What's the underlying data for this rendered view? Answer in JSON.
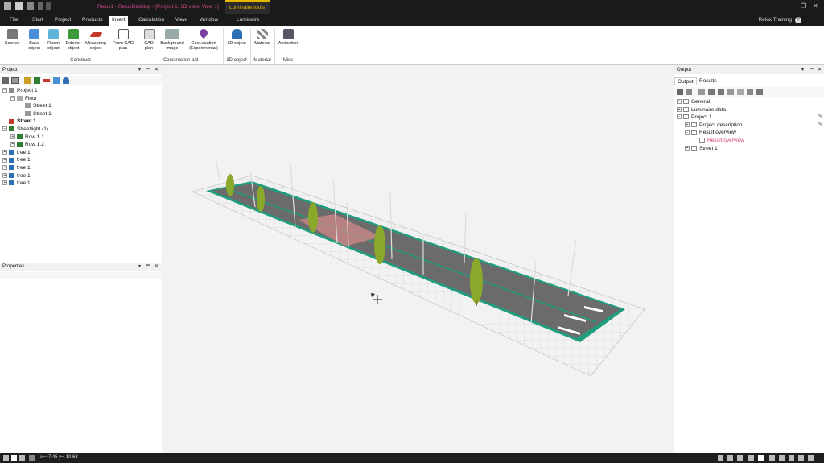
{
  "titlebar": {
    "document_title": "Relux1 - ReluxDesktop - [Project 1: 3D view, View 1]",
    "context_tab": "Luminaire tools"
  },
  "menu": {
    "items": [
      "File",
      "Start",
      "Project",
      "Products",
      "Insert",
      "Calculation",
      "View",
      "Window",
      "Luminaire"
    ],
    "active": "Insert",
    "user": "Relux Training",
    "help": "?"
  },
  "ribbon": {
    "scenes": "Scenes",
    "base_object": "Base object",
    "room_object": "Room object",
    "exterior_object": "Exterior object",
    "measuring_object": "Measuring object",
    "from_cad_plan": "From CAD plan",
    "cad_plan": "CAD plan",
    "background_image": "Background image",
    "geolocation": "GeoLocation (Experimental)",
    "object_3d": "3D object",
    "material": "Material",
    "animation": "Animation",
    "group_construct": "Construct",
    "group_construction_aid": "Construction aid",
    "group_3d_object": "3D object",
    "group_material": "Material",
    "group_misc": "Misc"
  },
  "project_panel": {
    "title": "Project",
    "tree": [
      {
        "label": "Project 1",
        "indent": 0,
        "exp": "-",
        "icon": "project-icon",
        "color": "#888"
      },
      {
        "label": "Floor",
        "indent": 1,
        "exp": "-",
        "icon": "floor-icon",
        "color": "#aaa"
      },
      {
        "label": "Street 1",
        "indent": 2,
        "exp": "",
        "icon": "street-plane-icon",
        "color": "#999"
      },
      {
        "label": "Street 1",
        "indent": 2,
        "exp": "",
        "icon": "street-plane-icon",
        "color": "#999"
      },
      {
        "label": "Street 1",
        "indent": 0,
        "exp": "",
        "icon": "street-icon",
        "color": "#c0392b",
        "bold": true
      },
      {
        "label": "Streetlight (1)",
        "indent": 0,
        "exp": "-",
        "icon": "streetlight-icon",
        "color": "#2e7d32"
      },
      {
        "label": "Row  1.1",
        "indent": 1,
        "exp": "+",
        "icon": "luminaire-row-icon",
        "color": "#2e7d32"
      },
      {
        "label": "Row  1.2",
        "indent": 1,
        "exp": "+",
        "icon": "luminaire-row-icon",
        "color": "#2e7d32"
      },
      {
        "label": "tree 1",
        "indent": 0,
        "exp": "+",
        "icon": "tree-object-icon",
        "color": "#2d6fb3"
      },
      {
        "label": "tree 1",
        "indent": 0,
        "exp": "+",
        "icon": "tree-object-icon",
        "color": "#2d6fb3"
      },
      {
        "label": "tree 1",
        "indent": 0,
        "exp": "+",
        "icon": "tree-object-icon",
        "color": "#2d6fb3"
      },
      {
        "label": "tree 1",
        "indent": 0,
        "exp": "+",
        "icon": "tree-object-icon",
        "color": "#2d6fb3"
      },
      {
        "label": "tree 1",
        "indent": 0,
        "exp": "+",
        "icon": "tree-object-icon",
        "color": "#2d6fb3"
      }
    ]
  },
  "properties_panel": {
    "title": "Properties"
  },
  "output_panel": {
    "title": "Output",
    "tabs": [
      "Output",
      "Results"
    ],
    "active_tab": "Output",
    "tree": [
      {
        "label": "General",
        "indent": 0,
        "exp": "+"
      },
      {
        "label": "Luminaire data",
        "indent": 0,
        "exp": "+"
      },
      {
        "label": "Project 1",
        "indent": 0,
        "exp": "-"
      },
      {
        "label": "Project description",
        "indent": 1,
        "exp": "+"
      },
      {
        "label": "Result overview",
        "indent": 1,
        "exp": "-"
      },
      {
        "label": "Result overview",
        "indent": 2,
        "exp": "",
        "highlight": true
      },
      {
        "label": "Street 1",
        "indent": 1,
        "exp": "+"
      }
    ]
  },
  "statusbar": {
    "coords": "x=47.45 y=-10.63"
  },
  "colors": {
    "title_accent": "#d04a8a",
    "context_tab": "#e6b800",
    "road": "#6b6b6b",
    "verge": "#1f9e7f",
    "tree": "#8aa82a",
    "highlight_text": "#d43f7a"
  }
}
